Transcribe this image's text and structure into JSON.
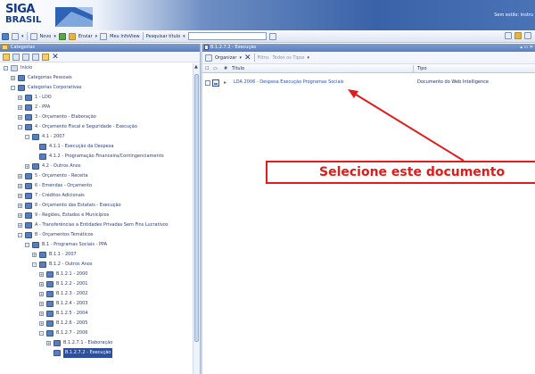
{
  "header": {
    "logo_top": "SIGA",
    "logo_bottom": "BRASIL",
    "user_text": "Sem estilo: instru"
  },
  "toolbar": {
    "novo_label": "Novo",
    "enviar_label": "Enviar",
    "infoview_label": "Meu InfoView",
    "search_label": "Pesquisar título",
    "search_value": ""
  },
  "left_panel": {
    "title": "Categorias",
    "tree": [
      {
        "label": "Inicio",
        "level": 0,
        "expand": "-",
        "icon": "root"
      },
      {
        "label": "Categorias Pessoais",
        "level": 1,
        "expand": "+",
        "icon": "folder"
      },
      {
        "label": "Categorias Corporativas",
        "level": 1,
        "expand": "-",
        "icon": "folder"
      },
      {
        "label": "1 - LDO",
        "level": 2,
        "expand": "+",
        "icon": "folder"
      },
      {
        "label": "2 - PPA",
        "level": 2,
        "expand": "+",
        "icon": "folder"
      },
      {
        "label": "3 - Orçamento - Elaboração",
        "level": 2,
        "expand": "+",
        "icon": "folder"
      },
      {
        "label": "4 - Orçamento Fiscal e Seguridade - Execução",
        "level": 2,
        "expand": "-",
        "icon": "folder"
      },
      {
        "label": "4.1 - 2007",
        "level": 3,
        "expand": "-",
        "icon": "folder"
      },
      {
        "label": "4.1.1 - Execução da Despesa",
        "level": 4,
        "expand": "",
        "icon": "folder"
      },
      {
        "label": "4.1.2 - Programação Financeira/Contingenciamento",
        "level": 4,
        "expand": "",
        "icon": "folder"
      },
      {
        "label": "4.2 - Outros Anos",
        "level": 3,
        "expand": "+",
        "icon": "folder"
      },
      {
        "label": "5 - Orçamento - Receita",
        "level": 2,
        "expand": "+",
        "icon": "folder"
      },
      {
        "label": "6 - Emendas - Orçamento",
        "level": 2,
        "expand": "+",
        "icon": "folder"
      },
      {
        "label": "7 - Créditos Adicionais",
        "level": 2,
        "expand": "+",
        "icon": "folder"
      },
      {
        "label": "8 - Orçamento das Estatais - Execução",
        "level": 2,
        "expand": "+",
        "icon": "folder"
      },
      {
        "label": "9 - Regiões, Estados e Municípios",
        "level": 2,
        "expand": "+",
        "icon": "folder"
      },
      {
        "label": "A - Transferências a Entidades Privadas Sem Fins Lucrativos",
        "level": 2,
        "expand": "+",
        "icon": "folder"
      },
      {
        "label": "B - Orçamentos Temáticos",
        "level": 2,
        "expand": "-",
        "icon": "folder"
      },
      {
        "label": "B.1 - Programas Sociais - PPA",
        "level": 3,
        "expand": "-",
        "icon": "folder"
      },
      {
        "label": "B.1.1 - 2007",
        "level": 4,
        "expand": "+",
        "icon": "folder"
      },
      {
        "label": "B.1.2 - Outros Anos",
        "level": 4,
        "expand": "-",
        "icon": "folder"
      },
      {
        "label": "B.1.2.1 - 2000",
        "level": 5,
        "expand": "+",
        "icon": "folder"
      },
      {
        "label": "B.1.2.2 - 2001",
        "level": 5,
        "expand": "+",
        "icon": "folder"
      },
      {
        "label": "B.1.2.3 - 2002",
        "level": 5,
        "expand": "+",
        "icon": "folder"
      },
      {
        "label": "B.1.2.4 - 2003",
        "level": 5,
        "expand": "+",
        "icon": "folder"
      },
      {
        "label": "B.1.2.5 - 2004",
        "level": 5,
        "expand": "+",
        "icon": "folder"
      },
      {
        "label": "B.1.2.6 - 2005",
        "level": 5,
        "expand": "+",
        "icon": "folder"
      },
      {
        "label": "B.1.2.7 - 2006",
        "level": 5,
        "expand": "-",
        "icon": "folder"
      },
      {
        "label": "B.1.2.7.1 - Elaboração",
        "level": 6,
        "expand": "+",
        "icon": "folder"
      },
      {
        "label": "B.1.2.7.2 - Execução",
        "level": 6,
        "expand": "",
        "icon": "folder",
        "selected": true
      }
    ]
  },
  "right_panel": {
    "title": "B.1.2.7.2 - Execução",
    "organize_label": "Organizar",
    "filter_label": "Filtro:",
    "filter_placeholder": "Todos os Tipos",
    "col_title": "Título",
    "col_type": "Tipo",
    "document": {
      "name": "LDA 2006 - Despesa Execução Programas Sociais",
      "type": "Documento do Web Intelligence"
    }
  },
  "annotation": {
    "text": "Selecione este documento",
    "color": "#e01b1b"
  }
}
